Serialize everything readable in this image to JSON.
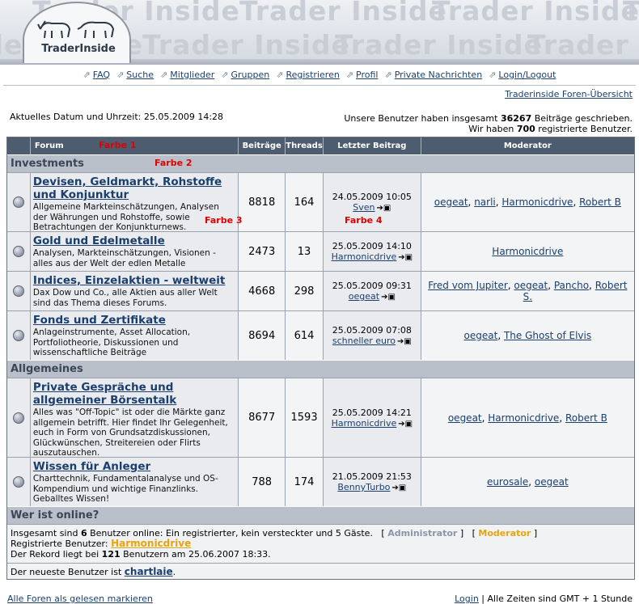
{
  "header": {
    "watermark": "Trader Inside",
    "logo_text": "TraderInside"
  },
  "nav": [
    {
      "label": "FAQ"
    },
    {
      "label": "Suche"
    },
    {
      "label": "Mitglieder"
    },
    {
      "label": "Gruppen"
    },
    {
      "label": "Registrieren"
    },
    {
      "label": "Profil"
    },
    {
      "label": "Private Nachrichten"
    },
    {
      "label": "Login/Logout"
    }
  ],
  "overview_link": "Traderinside Foren-Übersicht",
  "datetime": "Aktuelles Datum und Uhrzeit: 25.05.2009 14:28",
  "stats": {
    "line1_pre": "Unsere Benutzer haben insgesamt ",
    "posts_total": "36267",
    "line1_post": " Beiträge geschrieben.",
    "line2_pre": "Wir haben ",
    "users_total": "700",
    "line2_post": " registrierte Benutzer."
  },
  "table": {
    "headers": {
      "forum": "Forum",
      "posts": "Beiträge",
      "threads": "Threads",
      "last": "Letzter Beitrag",
      "moderator": "Moderator"
    },
    "annotations": {
      "farbe1": "Farbe 1",
      "farbe2": "Farbe 2",
      "farbe3": "Farbe 3",
      "farbe4": "Farbe 4"
    },
    "categories": {
      "investments": "Investments",
      "allgemeines": "Allgemeines"
    },
    "forums": [
      {
        "title": "Devisen, Geldmarkt, Rohstoffe und Konjunktur",
        "desc": "Allgemeine Markteinschätzungen, Analysen der Währungen und Rohstoffe, sowie Betrachtungen der Konjunkturnews.",
        "posts": "8818",
        "threads": "164",
        "last_date": "24.05.2009 10:05",
        "last_user": "Sven",
        "moderators": [
          "oegeat",
          "narli",
          "Harmonicdrive",
          "Robert B"
        ]
      },
      {
        "title": "Gold und Edelmetalle",
        "desc": "Analysen, Markteinschätzungen, Visionen - alles aus der Welt der edlen Metalle",
        "posts": "2473",
        "threads": "13",
        "last_date": "25.05.2009 14:10",
        "last_user": "Harmonicdrive",
        "moderators": [
          "Harmonicdrive"
        ]
      },
      {
        "title": "Indices, Einzelaktien - weltweit",
        "desc": "Dax Dow und Co., alle Aktien aus aller Welt sind das Thema dieses Forums.",
        "posts": "4668",
        "threads": "298",
        "last_date": "25.05.2009 09:31",
        "last_user": "oegeat",
        "moderators": [
          "Fred vom Jupiter",
          "oegeat",
          "Pancho",
          "Robert S."
        ]
      },
      {
        "title": "Fonds und Zertifikate",
        "desc": "Anlageinstrumente, Asset Allocation, Portfoliotheorie, Diskussionen und wissenschaftliche Beiträge",
        "posts": "8694",
        "threads": "614",
        "last_date": "25.05.2009 07:08",
        "last_user": "schneller euro",
        "moderators": [
          "oegeat",
          "The Ghost of Elvis"
        ]
      },
      {
        "title": "Private Gespräche und allgemeiner Börsentalk",
        "desc": "Alles was \"Off-Topic\" ist oder die Märkte ganz allgemein betrifft. Hier findet Ihr Gelegenheit, euch in Form von Grundsatzdiskussionen, Glückwünschen, Streitereien oder Flirts auszutauschen.",
        "posts": "8677",
        "threads": "1593",
        "last_date": "25.05.2009 14:21",
        "last_user": "Harmonicdrive",
        "moderators": [
          "oegeat",
          "Harmonicdrive",
          "Robert B"
        ]
      },
      {
        "title": "Wissen für Anleger",
        "desc": "Charttechnik, Fundamentalanalyse und OS-Kompendium und wichtige Finanzlinks. Geballtes Wissen!",
        "posts": "788",
        "threads": "174",
        "last_date": "21.05.2009 21:53",
        "last_user": "BennyTurbo",
        "moderators": [
          "eurosale",
          "oegeat"
        ]
      }
    ]
  },
  "online": {
    "title": "Wer ist online?",
    "line1_pre": "Insgesamt sind ",
    "count": "6",
    "line1_post": " Benutzer online: Ein registrierter, kein versteckter und 5 Gäste.",
    "admin_label": "Administrator",
    "mod_label": "Moderator",
    "registered_label": "Registrierte Benutzer:",
    "registered_user": "Harmonicdrive",
    "record_pre": "Der Rekord liegt bei ",
    "record_count": "121",
    "record_post": " Benutzern am 25.06.2007 18:33.",
    "newest_pre": "Der neueste Benutzer ist ",
    "newest_user": "chartlaie"
  },
  "footer": {
    "mark_read": "Alle Foren als gelesen markieren",
    "login": "Login",
    "timezone": "Alle Zeiten sind GMT + 1 Stunde"
  },
  "colors": {
    "header_bar": "#4e5c70",
    "category_bar": "#b9c0ca",
    "link": "#1a3f6e",
    "moderator": "#e6a40f"
  }
}
